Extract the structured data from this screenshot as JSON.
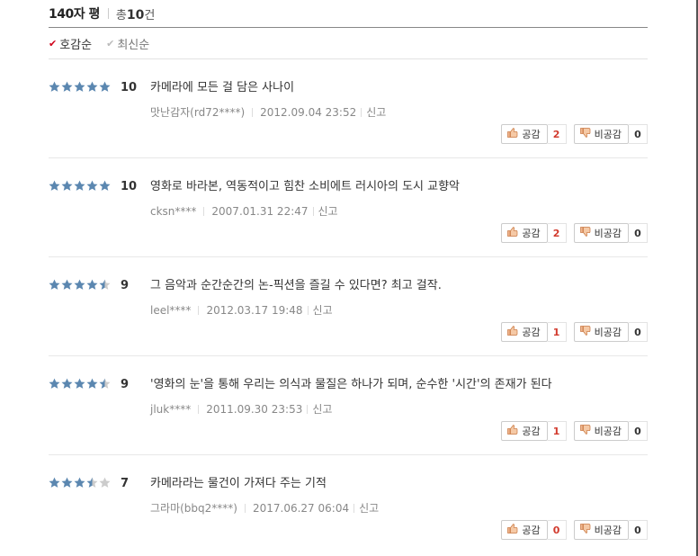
{
  "header": {
    "title": "140자 평",
    "total_prefix": "총",
    "total_count": "10",
    "total_suffix": "건"
  },
  "sort": {
    "options": [
      {
        "label": "호감순",
        "active": true
      },
      {
        "label": "최신순",
        "active": false
      }
    ]
  },
  "buttons": {
    "like_label": "공감",
    "dislike_label": "비공감"
  },
  "reviews": [
    {
      "rating": 10,
      "stars": 5,
      "score": "10",
      "text": "카메라에 모든 걸 담은 사나이",
      "user": "맛난감자(rd72****)",
      "date": "2012.09.04 23:52",
      "report": "신고",
      "likes": "2",
      "dislikes": "0"
    },
    {
      "rating": 10,
      "stars": 5,
      "score": "10",
      "text": "영화로 바라본, 역동적이고 힘찬 소비에트 러시아의 도시 교향악",
      "user": "cksn****",
      "date": "2007.01.31 22:47",
      "report": "신고",
      "likes": "2",
      "dislikes": "0"
    },
    {
      "rating": 9,
      "stars": 4.5,
      "score": "9",
      "text": "그 음악과 순간순간의 논-픽션을 즐길 수 있다면? 최고 걸작.",
      "user": "leel****",
      "date": "2012.03.17 19:48",
      "report": "신고",
      "likes": "1",
      "dislikes": "0"
    },
    {
      "rating": 9,
      "stars": 4.5,
      "score": "9",
      "text": "'영화의 눈'을 통해 우리는 의식과 물질은 하나가 되며, 순수한 '시간'의 존재가 된다",
      "user": "jluk****",
      "date": "2011.09.30 23:53",
      "report": "신고",
      "likes": "1",
      "dislikes": "0"
    },
    {
      "rating": 7,
      "stars": 3.5,
      "score": "7",
      "text": "카메라라는 물건이 가져다 주는 기적",
      "user": "그라마(bbq2****)",
      "date": "2017.06.27 06:04",
      "report": "신고",
      "likes": "0",
      "dislikes": "0"
    }
  ],
  "colors": {
    "star_filled": "#5b87b0",
    "star_empty": "#cccccc",
    "like_count": "#d23b2e",
    "sort_check": "#d0021b"
  },
  "icons": {
    "like": "thumbs-up-icon",
    "dislike": "thumbs-down-icon",
    "sort": "check-icon",
    "rating": "star-icon"
  }
}
